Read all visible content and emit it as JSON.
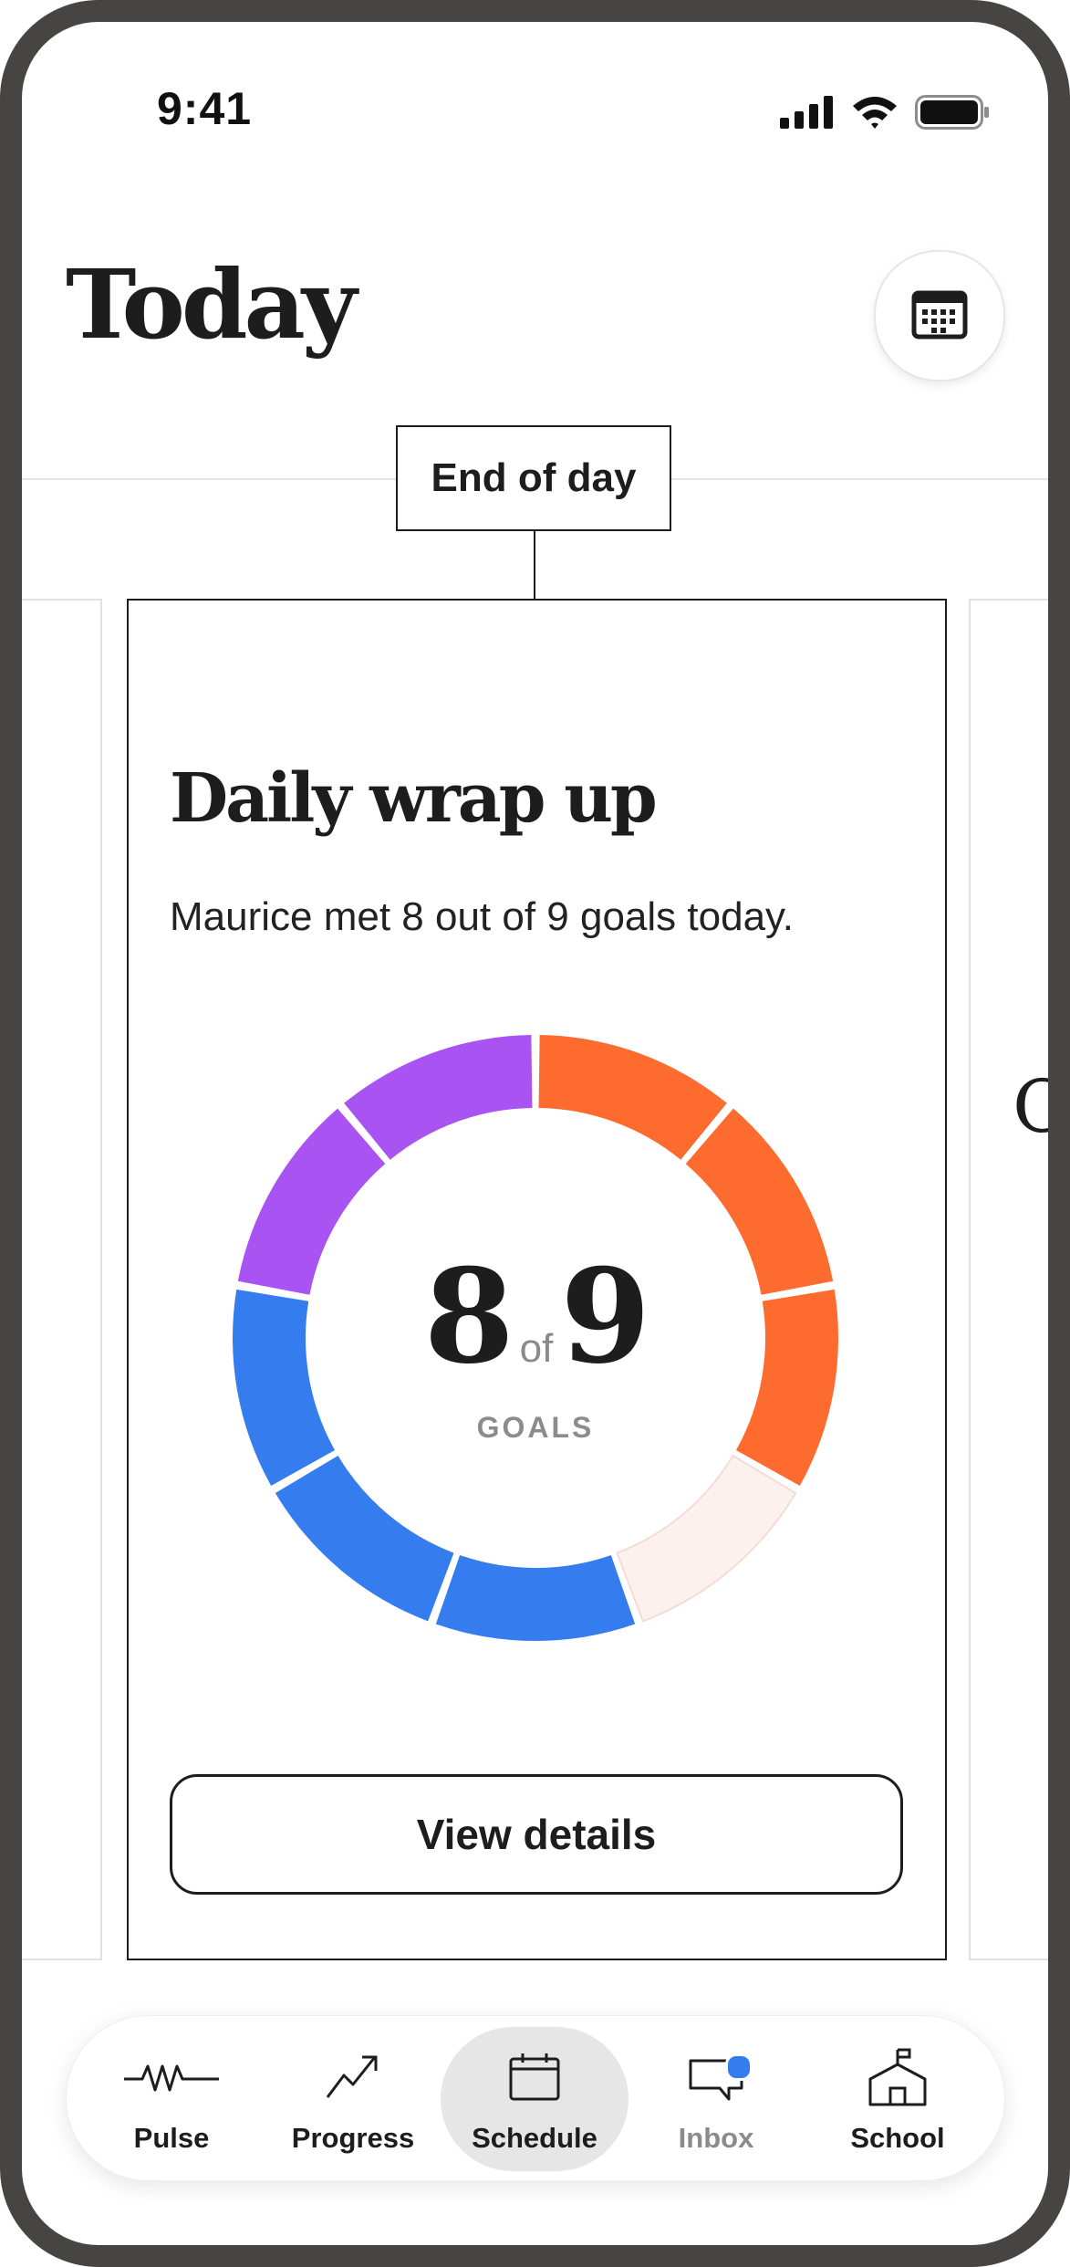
{
  "status_bar": {
    "time": "9:41"
  },
  "header": {
    "title": "Today"
  },
  "section": {
    "label": "End of day"
  },
  "next_card_peek": "C",
  "card": {
    "title": "Daily wrap up",
    "subtitle": "Maurice met 8 out of 9 goals today.",
    "progress": {
      "met": "8",
      "connector": "of",
      "total": "9",
      "unit": "GOALS"
    },
    "segments": [
      {
        "met": true,
        "color": "#fd6b2f"
      },
      {
        "met": true,
        "color": "#fd6b2f"
      },
      {
        "met": true,
        "color": "#fd6b2f"
      },
      {
        "met": false,
        "color": "#fcf1ee"
      },
      {
        "met": true,
        "color": "#357dee"
      },
      {
        "met": true,
        "color": "#357dee"
      },
      {
        "met": true,
        "color": "#357dee"
      },
      {
        "met": true,
        "color": "#a853f2"
      },
      {
        "met": true,
        "color": "#a853f2"
      }
    ],
    "button_label": "View details"
  },
  "nav": {
    "items": [
      {
        "label": "Pulse",
        "icon": "pulse-icon"
      },
      {
        "label": "Progress",
        "icon": "trend-up-icon"
      },
      {
        "label": "Schedule",
        "icon": "calendar-icon",
        "active": true
      },
      {
        "label": "Inbox",
        "icon": "inbox-icon",
        "badge": true
      },
      {
        "label": "School",
        "icon": "school-icon"
      }
    ]
  },
  "colors": {
    "orange": "#fd6b2f",
    "blue": "#357dee",
    "purple": "#a853f2",
    "unmet": "#fcf1ee",
    "frame": "#474544"
  }
}
